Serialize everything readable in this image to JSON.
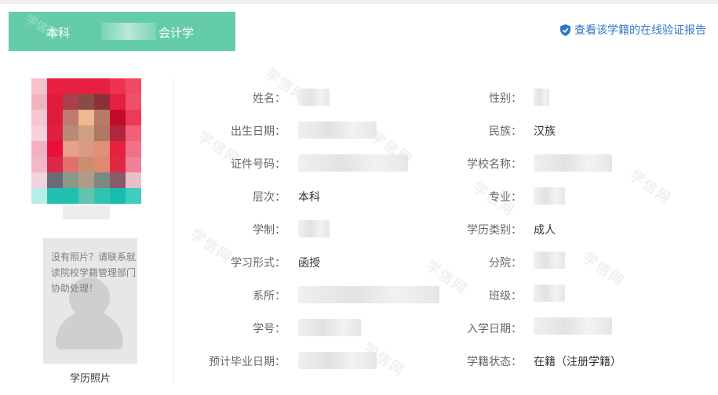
{
  "tab": {
    "level": "本科",
    "major": "会计学"
  },
  "verify_link": "查看该学籍的在线验证报告",
  "no_photo_message": "没有照片？请联系就读院校学籍管理部门协助处理！",
  "photo_caption": "学历照片",
  "watermark": "学信网",
  "left_fields": [
    {
      "label": "姓名：",
      "value": ""
    },
    {
      "label": "出生日期：",
      "value": ""
    },
    {
      "label": "证件号码：",
      "value": ""
    },
    {
      "label": "层次：",
      "value": "本科"
    },
    {
      "label": "学制：",
      "value": ""
    },
    {
      "label": "学习形式：",
      "value": "函授"
    },
    {
      "label": "系所：",
      "value": ""
    },
    {
      "label": "学号：",
      "value": ""
    },
    {
      "label": "预计毕业日期：",
      "value": ""
    }
  ],
  "right_fields": [
    {
      "label": "性别：",
      "value": ""
    },
    {
      "label": "民族：",
      "value": "汉族"
    },
    {
      "label": "学校名称：",
      "value": ""
    },
    {
      "label": "专业：",
      "value": ""
    },
    {
      "label": "学历类别：",
      "value": "成人"
    },
    {
      "label": "分院：",
      "value": ""
    },
    {
      "label": "班级：",
      "value": ""
    },
    {
      "label": "入学日期：",
      "value": ""
    },
    {
      "label": "学籍状态：",
      "value": "在籍（注册学籍）"
    }
  ],
  "colors": {
    "tab_bg": "#64ccaa",
    "link": "#2f78c8",
    "label": "#666666",
    "value": "#333333"
  },
  "icons": {
    "verify": "shield-check-icon",
    "no_photo": "person-silhouette-icon"
  }
}
